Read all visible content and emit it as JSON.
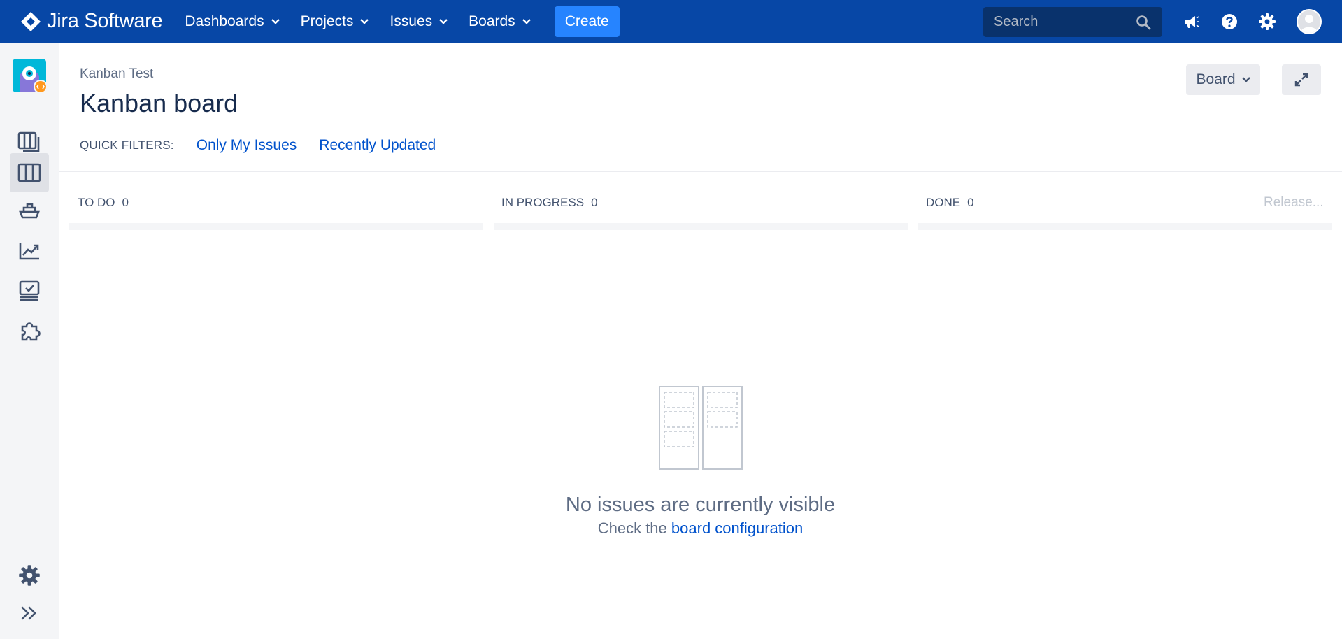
{
  "app": {
    "name": "Jira Software"
  },
  "topnav": {
    "items": [
      {
        "label": "Dashboards"
      },
      {
        "label": "Projects"
      },
      {
        "label": "Issues"
      },
      {
        "label": "Boards"
      }
    ],
    "create_label": "Create",
    "search": {
      "placeholder": "Search",
      "value": ""
    },
    "icons": [
      "megaphone-icon",
      "help-icon",
      "settings-icon",
      "user-avatar"
    ]
  },
  "sidebar": {
    "items": [
      {
        "icon": "project-avatar"
      },
      {
        "icon": "backlog-icon"
      },
      {
        "icon": "board-icon",
        "active": true
      },
      {
        "icon": "releases-icon"
      },
      {
        "icon": "reports-icon"
      },
      {
        "icon": "issues-icon"
      },
      {
        "icon": "add-ons-icon"
      }
    ],
    "bottom": [
      {
        "icon": "project-settings-icon"
      },
      {
        "icon": "expand-sidebar-icon"
      }
    ]
  },
  "header": {
    "breadcrumb": "Kanban Test",
    "title": "Kanban board",
    "board_button_label": "Board"
  },
  "quick_filters": {
    "label": "QUICK FILTERS:",
    "items": [
      "Only My Issues",
      "Recently Updated"
    ]
  },
  "columns": [
    {
      "name": "TO DO",
      "count": "0"
    },
    {
      "name": "IN PROGRESS",
      "count": "0"
    },
    {
      "name": "DONE",
      "count": "0"
    }
  ],
  "release_label": "Release...",
  "empty_state": {
    "title": "No issues are currently visible",
    "subtitle_prefix": "Check the",
    "link": "board configuration"
  },
  "colors": {
    "nav_bg": "#0747a6",
    "create_bg": "#2684ff",
    "link": "#0052cc",
    "sidebar_bg": "#f4f5f7"
  }
}
